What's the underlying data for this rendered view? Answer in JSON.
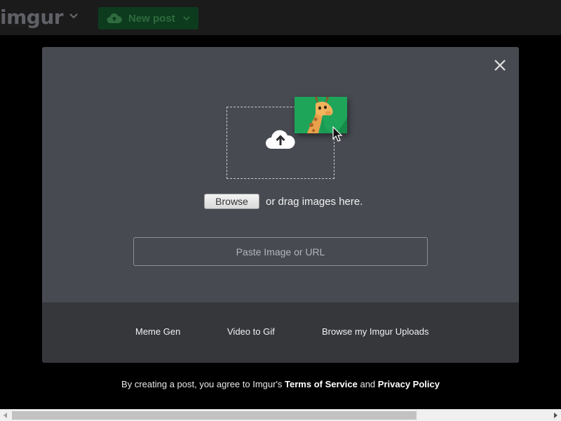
{
  "header": {
    "logo_text": "imgur",
    "logo_menu_icon": "chevron-down-icon",
    "new_post_label": "New post",
    "new_post_icon": "cloud-upload-icon",
    "new_post_chevron": "chevron-down-icon"
  },
  "modal": {
    "close_icon": "close-icon",
    "dropzone_icon": "cloud-upload-icon",
    "preview_image": "giraffe-image",
    "browse_label": "Browse",
    "drag_text": "or drag images here.",
    "url_placeholder": "Paste Image or URL",
    "footer_links": [
      {
        "label": "Meme Gen"
      },
      {
        "label": "Video to Gif"
      },
      {
        "label": "Browse my Imgur Uploads"
      }
    ]
  },
  "terms": {
    "prefix": "By creating a post, you agree to Imgur's ",
    "tos": "Terms of Service",
    "and": " and ",
    "privacy": "Privacy Policy"
  },
  "colors": {
    "accent_green": "#1fa55a",
    "modal_bg": "#474a51",
    "footer_bg": "#35373b"
  }
}
